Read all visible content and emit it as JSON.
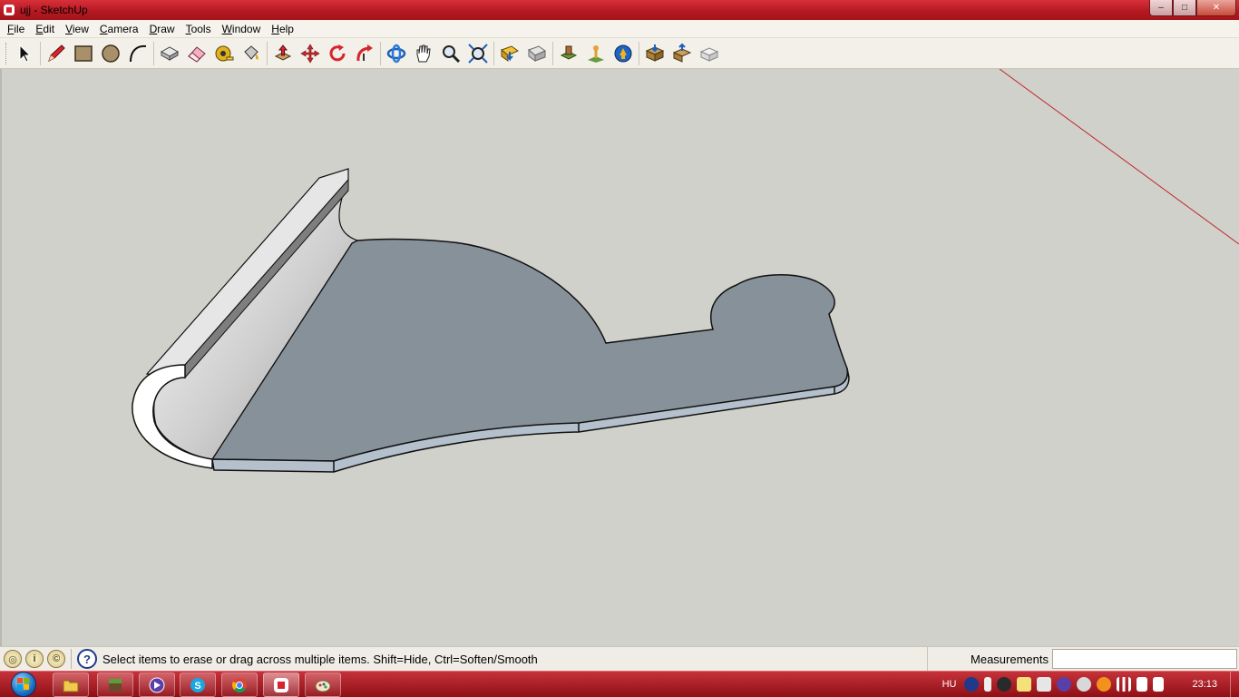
{
  "window": {
    "title": "ujj - SketchUp",
    "controls": {
      "minimize": "–",
      "maximize": "□",
      "close": "✕"
    }
  },
  "menu": [
    {
      "accel": "F",
      "rest": "ile"
    },
    {
      "accel": "E",
      "rest": "dit"
    },
    {
      "accel": "V",
      "rest": "iew"
    },
    {
      "accel": "C",
      "rest": "amera"
    },
    {
      "accel": "D",
      "rest": "raw"
    },
    {
      "accel": "T",
      "rest": "ools"
    },
    {
      "accel": "W",
      "rest": "indow"
    },
    {
      "accel": "H",
      "rest": "elp"
    }
  ],
  "toolbar": {
    "tools": [
      "select-icon",
      "pencil-icon",
      "rectangle-icon",
      "circle-icon",
      "arc-icon",
      "make-component-icon",
      "eraser-icon",
      "tape-measure-icon",
      "paint-bucket-icon",
      "push-pull-icon",
      "move-icon",
      "rotate-icon",
      "follow-me-icon",
      "orbit-icon",
      "pan-icon",
      "zoom-icon",
      "zoom-extents-icon",
      "get-models-icon",
      "share-model-icon",
      "add-location-icon",
      "toggle-terrain-icon",
      "google-earth-icon",
      "get-models-warehouse-icon",
      "share-component-icon",
      "preview-icon"
    ],
    "active_tool": "eraser-icon"
  },
  "status": {
    "hint": "Select items to erase or drag across multiple items. Shift=Hide, Ctrl=Soften/Smooth",
    "measurements_label": "Measurements",
    "measurements_value": "",
    "icons": [
      "geo-location-icon",
      "credits-icon",
      "copyright-icon",
      "instructor-help-icon"
    ]
  },
  "taskbar": {
    "apps": [
      "file-explorer",
      "minecraft",
      "media-player",
      "skype",
      "chrome",
      "sketchup",
      "paint"
    ],
    "language": "HU",
    "time": "23:13"
  },
  "colors": {
    "titlebar": "#b31821",
    "viewport": "#d1d1cb",
    "face_front": "#87919a",
    "face_back": "#ffffff",
    "red_axis": "#c0262e"
  }
}
